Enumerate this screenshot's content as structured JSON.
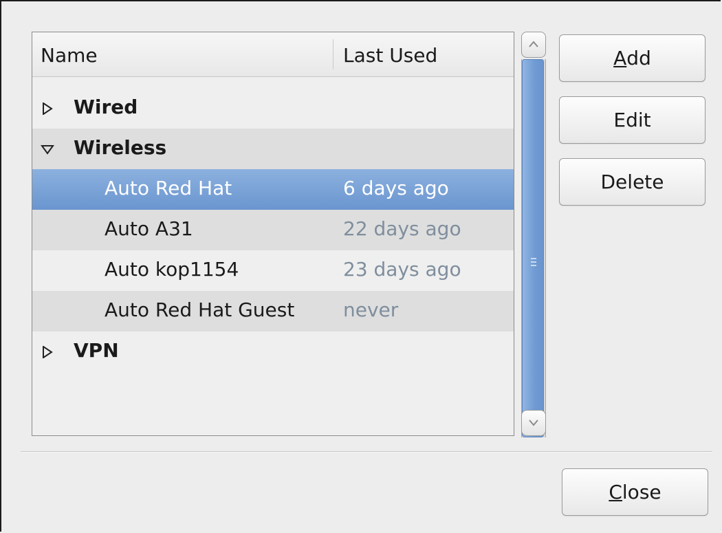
{
  "columns": {
    "name": "Name",
    "last_used": "Last Used"
  },
  "groups": {
    "wired": {
      "label": "Wired",
      "expanded": false
    },
    "wireless": {
      "label": "Wireless",
      "expanded": true
    },
    "vpn": {
      "label": "VPN",
      "expanded": false
    }
  },
  "connections": [
    {
      "name": "Auto Red Hat",
      "last_used": "6 days ago",
      "selected": true
    },
    {
      "name": "Auto A31",
      "last_used": "22 days ago",
      "selected": false
    },
    {
      "name": "Auto kop1154",
      "last_used": "23 days ago",
      "selected": false
    },
    {
      "name": "Auto Red Hat Guest",
      "last_used": "never",
      "selected": false
    }
  ],
  "buttons": {
    "add_mnemonic": "A",
    "add_rest": "dd",
    "edit": "Edit",
    "delete": "Delete",
    "close_mnemonic": "C",
    "close_rest": "lose"
  },
  "colors": {
    "selection": "#6a95cf",
    "secondary_text": "#7f8e9d",
    "stripe": "#dedede"
  },
  "icons": {
    "collapsed": "triangle-right-icon",
    "expanded": "triangle-down-icon",
    "scroll_up": "chevron-up-icon",
    "scroll_down": "chevron-down-icon"
  }
}
